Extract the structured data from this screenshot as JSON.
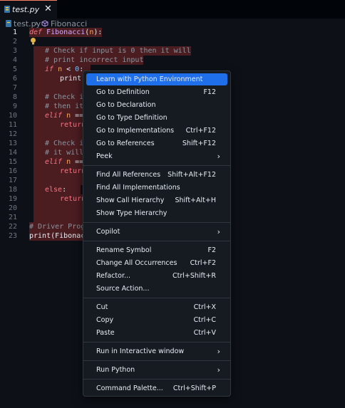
{
  "tab": {
    "label": "test.py",
    "close": "✕"
  },
  "breadcrumb": {
    "file": "test.py",
    "separator": "›",
    "symbol": "Fibonacci"
  },
  "line_numbers": [
    "1",
    "2",
    "3",
    "4",
    "5",
    "6",
    "7",
    "8",
    "9",
    "10",
    "11",
    "12",
    "13",
    "14",
    "15",
    "16",
    "17",
    "18",
    "19",
    "20",
    "21",
    "22",
    "23"
  ],
  "code": {
    "l1_def": "def",
    "l1_name": "Fibonacci",
    "l1_open": "(",
    "l1_param": "n",
    "l1_close": "):",
    "l3": "# Check if input is 0 then it will",
    "l4": "# print incorrect input",
    "l5_kw": "if",
    "l5_param": "n",
    "l5_op": " < ",
    "l5_num": "0",
    "l5_colon": ":",
    "l6": "print(",
    "l8": "# Check it",
    "l9": "# then it",
    "l10_kw": "elif",
    "l10_param": "n",
    "l10_op": " ==",
    "l11": "return",
    "l13": "# Check it",
    "l14": "# it will",
    "l15_kw": "elif",
    "l15_param": "n",
    "l15_op": " ==",
    "l16": "return",
    "l18_kw": "else",
    "l18_colon": ":",
    "l19": "return",
    "l22": "# Driver Progr",
    "l23": "print(Fibonacc"
  },
  "context_menu": {
    "learn": "Learn with Python Environment",
    "goto_definition": {
      "label": "Go to Definition",
      "key": "F12"
    },
    "goto_declaration": "Go to Declaration",
    "goto_type_definition": "Go to Type Definition",
    "goto_implementations": {
      "label": "Go to Implementations",
      "key": "Ctrl+F12"
    },
    "goto_references": {
      "label": "Go to References",
      "key": "Shift+F12"
    },
    "peek": "Peek",
    "find_all_references": {
      "label": "Find All References",
      "key": "Shift+Alt+F12"
    },
    "find_all_implementations": "Find All Implementations",
    "show_call_hierarchy": {
      "label": "Show Call Hierarchy",
      "key": "Shift+Alt+H"
    },
    "show_type_hierarchy": "Show Type Hierarchy",
    "copilot": "Copilot",
    "rename_symbol": {
      "label": "Rename Symbol",
      "key": "F2"
    },
    "change_all_occurrences": {
      "label": "Change All Occurrences",
      "key": "Ctrl+F2"
    },
    "refactor": {
      "label": "Refactor...",
      "key": "Ctrl+Shift+R"
    },
    "source_action": "Source Action...",
    "cut": {
      "label": "Cut",
      "key": "Ctrl+X"
    },
    "copy": {
      "label": "Copy",
      "key": "Ctrl+C"
    },
    "paste": {
      "label": "Paste",
      "key": "Ctrl+V"
    },
    "run_interactive": "Run in Interactive window",
    "run_python": "Run Python",
    "command_palette": {
      "label": "Command Palette...",
      "key": "Ctrl+Shift+P"
    },
    "submenu_arrow": "›"
  },
  "icons": {
    "python_file": "python-icon",
    "symbol": "cube-icon",
    "lightbulb": "lightbulb-icon"
  },
  "colors": {
    "accent": "#1f6feb",
    "highlight": "#4b1d21",
    "background": "#0d1117"
  }
}
